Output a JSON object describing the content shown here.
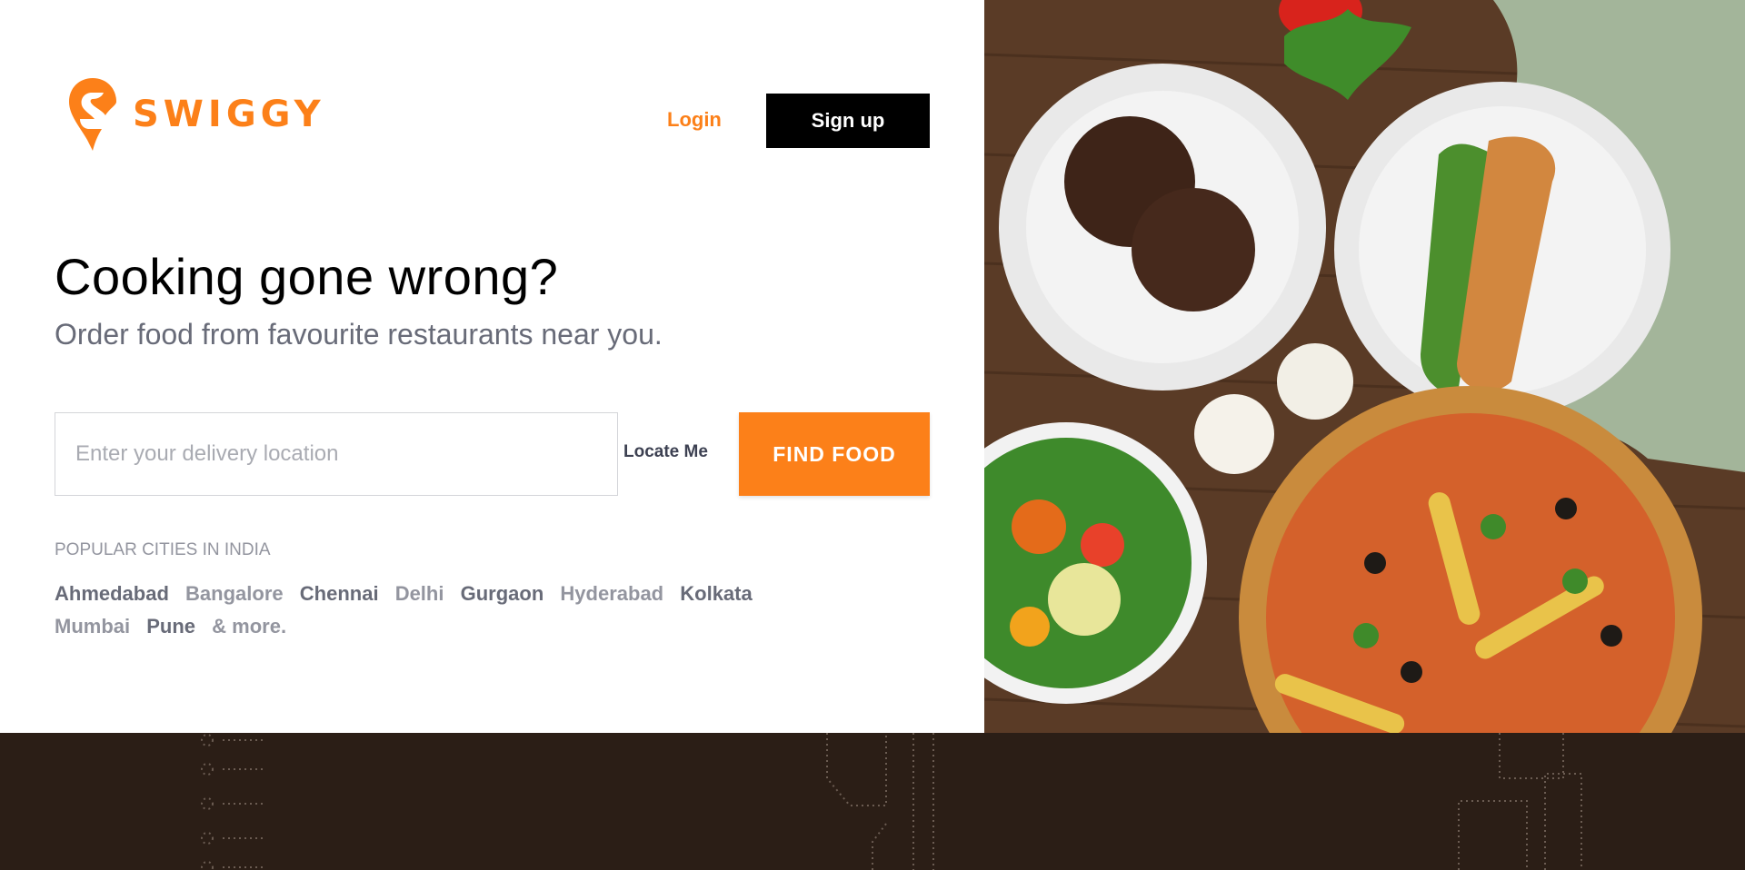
{
  "brand": {
    "name": "SWIGGY",
    "color": "#fc8019"
  },
  "header": {
    "login_label": "Login",
    "signup_label": "Sign up"
  },
  "hero": {
    "headline": "Cooking gone wrong?",
    "subline": "Order food from favourite restaurants near you."
  },
  "search": {
    "placeholder": "Enter your delivery location",
    "value": "",
    "locate_label": "Locate Me",
    "find_label": "FIND FOOD"
  },
  "cities": {
    "title": "POPULAR CITIES IN INDIA",
    "items": [
      "Ahmedabad",
      "Bangalore",
      "Chennai",
      "Delhi",
      "Gurgaon",
      "Hyderabad",
      "Kolkata",
      "Mumbai",
      "Pune"
    ],
    "more_label": "& more."
  },
  "photo": {
    "description_icon": "food-spread-image"
  },
  "colors": {
    "accent": "#fc8019",
    "dark": "#000000",
    "strip": "#2b1e16"
  }
}
